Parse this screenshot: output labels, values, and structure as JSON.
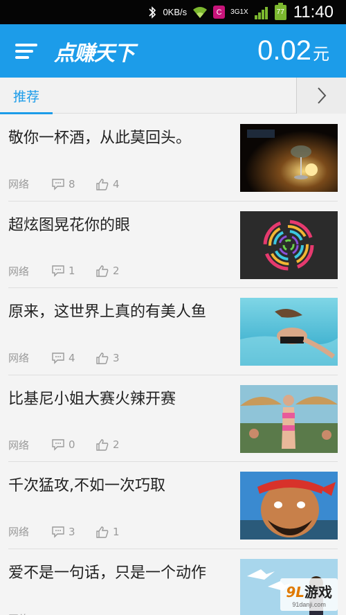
{
  "status_bar": {
    "speed": "0KB/s",
    "network_top": "3G",
    "network_bottom": "1X",
    "app_badge": "C",
    "battery": "77",
    "time": "11:40"
  },
  "header": {
    "logo": "点赚天下",
    "balance": "0.02",
    "balance_unit": "元"
  },
  "tabs": [
    {
      "label": "推荐"
    }
  ],
  "articles": [
    {
      "title": "敬你一杯酒，从此莫回头。",
      "source": "网络",
      "comments": "8",
      "likes": "4"
    },
    {
      "title": "超炫图晃花你的眼",
      "source": "网络",
      "comments": "1",
      "likes": "2"
    },
    {
      "title": "原来，这世界上真的有美人鱼",
      "source": "网络",
      "comments": "4",
      "likes": "3"
    },
    {
      "title": "比基尼小姐大赛火辣开赛",
      "source": "网络",
      "comments": "0",
      "likes": "2"
    },
    {
      "title": "千次猛攻,不如一次巧取",
      "source": "网络",
      "comments": "3",
      "likes": "1"
    },
    {
      "title": "爱不是一句话，只是一个动作",
      "source": "网络",
      "comments": "",
      "likes": ""
    }
  ],
  "watermark": {
    "brand_num": "9L",
    "brand_text": "游戏",
    "url": "91danji.com"
  },
  "colors": {
    "primary": "#1c9ce9",
    "status_bar": "#050505"
  }
}
